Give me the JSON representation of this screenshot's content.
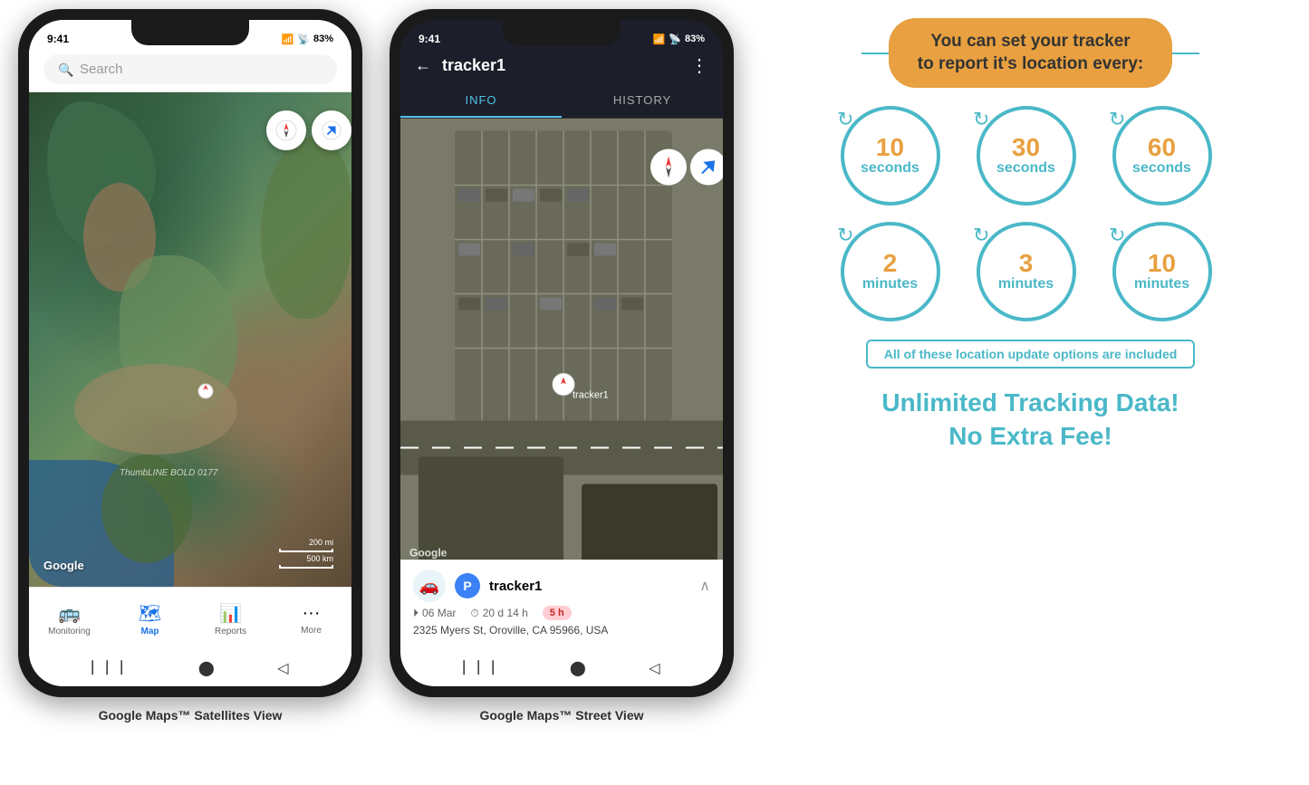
{
  "phones": {
    "phone1": {
      "status_time": "9:41",
      "status_battery": "83%",
      "search_placeholder": "Search",
      "google_logo": "Google",
      "scale_200mi": "200 mi",
      "scale_500km": "500 km",
      "nav_items": [
        {
          "id": "monitoring",
          "label": "Monitoring",
          "icon": "🚌",
          "active": false
        },
        {
          "id": "map",
          "label": "Map",
          "icon": "🗺",
          "active": true
        },
        {
          "id": "reports",
          "label": "Reports",
          "icon": "📊",
          "active": false
        },
        {
          "id": "more",
          "label": "More",
          "icon": "···",
          "active": false
        }
      ],
      "caption": "Google Maps™ Satellites View",
      "map_label": "ThumbLINE BOLD 0177"
    },
    "phone2": {
      "status_time": "9:41",
      "status_battery": "83%",
      "tracker_name": "tracker1",
      "back_label": "←",
      "more_label": "⋮",
      "tabs": [
        {
          "id": "info",
          "label": "INFO",
          "active": true
        },
        {
          "id": "history",
          "label": "HISTORY",
          "active": false
        }
      ],
      "info_panel": {
        "tracker_name": "tracker1",
        "date": "06 Mar",
        "duration": "20 d 14 h",
        "address": "2325 Myers St, Oroville, CA 95966, USA",
        "time_badge": "5 h",
        "google_logo": "Google"
      },
      "caption": "Google Maps™ Street View"
    }
  },
  "info_panel": {
    "headline": "You can set your tracker\nto report it's location every:",
    "teal_line": true,
    "circles": [
      {
        "number": "10",
        "unit": "seconds"
      },
      {
        "number": "30",
        "unit": "seconds"
      },
      {
        "number": "60",
        "unit": "seconds"
      },
      {
        "number": "2",
        "unit": "minutes"
      },
      {
        "number": "3",
        "unit": "minutes"
      },
      {
        "number": "10",
        "unit": "minutes"
      }
    ],
    "included_text": "All of these location update options are included",
    "unlimited_line1": "Unlimited Tracking Data!",
    "unlimited_line2": "No Extra Fee!"
  }
}
